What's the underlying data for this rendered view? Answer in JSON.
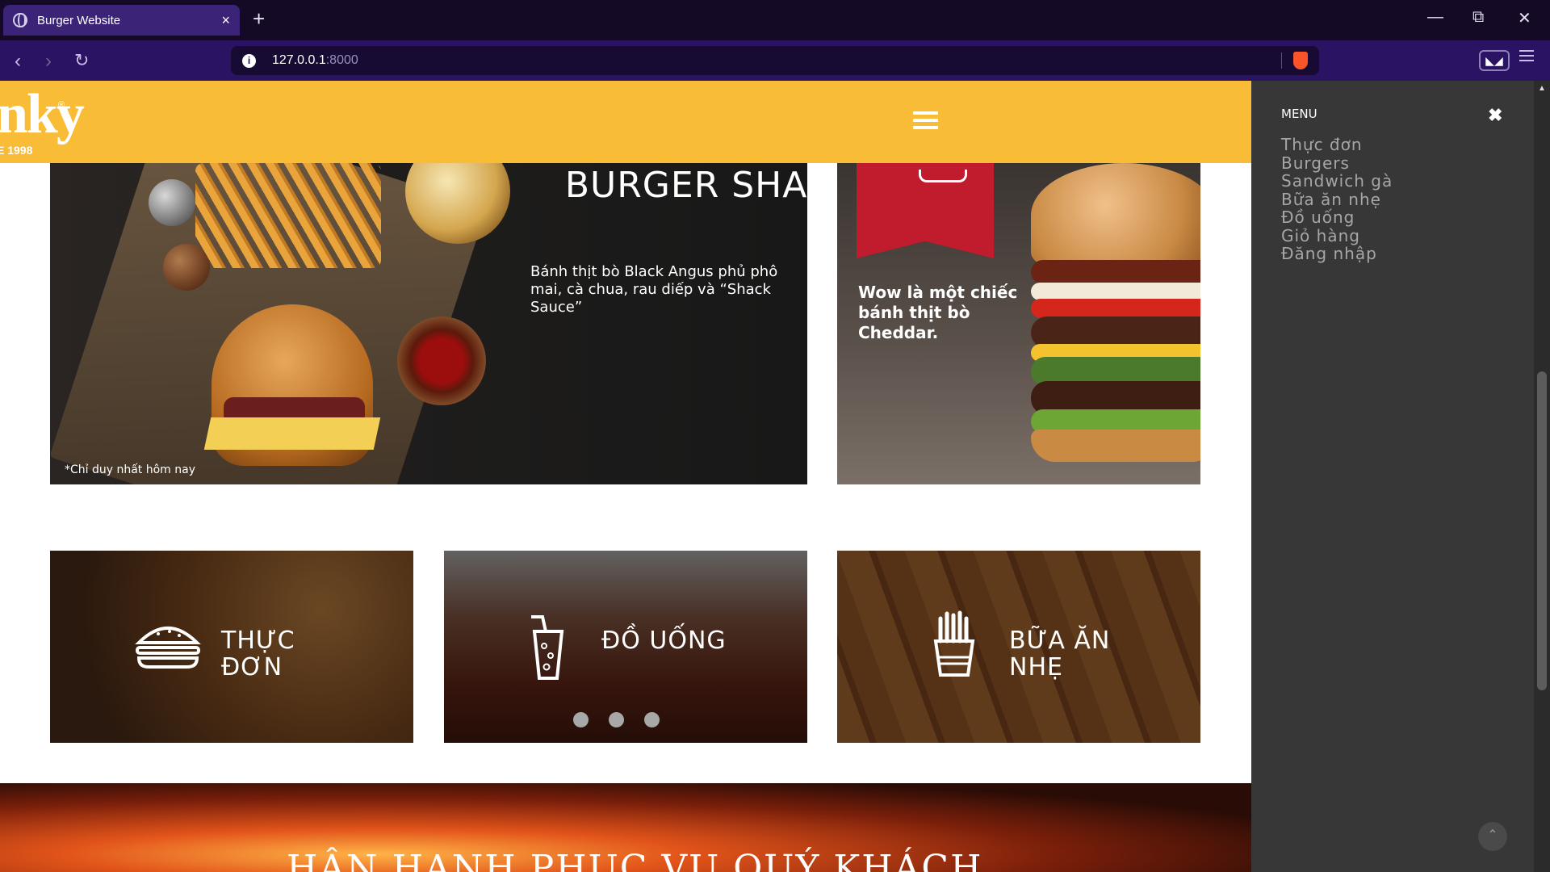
{
  "browser": {
    "tab_title": "Burger Website",
    "url_host": "127.0.0.1",
    "url_port": ":8000"
  },
  "header": {
    "logo_text": "nky",
    "logo_sub": "E 1998",
    "logo_reg": "®"
  },
  "banner_left": {
    "title": "BURGER SHACK",
    "description": "Bánh thịt bò Black Angus phủ phô mai, cà chua, rau diếp và “Shack Sauce”",
    "note": "*Chỉ duy nhất hôm nay"
  },
  "banner_right": {
    "text": "Wow là một chiếc bánh thịt bò Cheddar."
  },
  "categories": [
    {
      "label_line1": "THỰC",
      "label_line2": "ĐƠN"
    },
    {
      "label_line1": "ĐỒ UỐNG",
      "label_line2": ""
    },
    {
      "label_line1": "BỮA ĂN",
      "label_line2": "NHẸ"
    }
  ],
  "section_title": "HÂN HẠNH PHỤC VỤ QUÝ KHÁCH",
  "side_menu": {
    "title": "MENU",
    "close": "✖",
    "items": [
      "Thực đơn",
      "Burgers",
      "Sandwich gà",
      "Bữa ăn nhẹ",
      "Đồ uống",
      "Giỏ hàng",
      "Đăng nhập"
    ]
  },
  "colors": {
    "header": "#f8bc36",
    "ribbon": "#c11b2e",
    "side_menu_bg": "#373737"
  }
}
